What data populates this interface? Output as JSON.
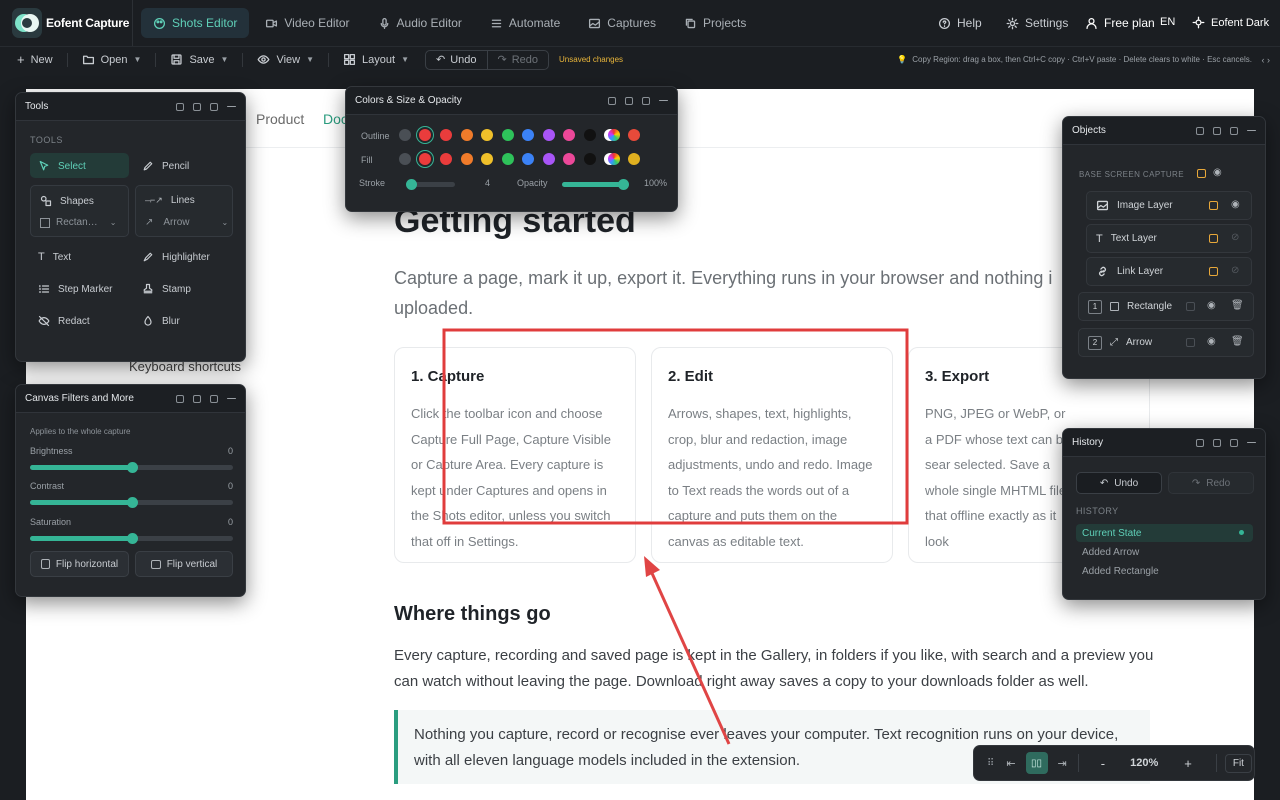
{
  "app": {
    "name": "Eofent Capture"
  },
  "tabs": [
    {
      "label": "Shots Editor",
      "icon": "palette-icon"
    },
    {
      "label": "Video Editor",
      "icon": "video-icon"
    },
    {
      "label": "Audio Editor",
      "icon": "mic-icon"
    },
    {
      "label": "Automate",
      "icon": "list-icon"
    },
    {
      "label": "Captures",
      "icon": "image-icon"
    },
    {
      "label": "Projects",
      "icon": "copy-icon"
    }
  ],
  "header_right": {
    "help": "Help",
    "settings": "Settings",
    "plan": "Free plan",
    "lang": "EN",
    "theme": "Eofent Dark"
  },
  "toolbar": {
    "new": "New",
    "open": "Open",
    "save": "Save",
    "view": "View",
    "layout": "Layout",
    "undo": "Undo",
    "redo": "Redo",
    "unsaved": "Unsaved changes",
    "hint": "Copy Region: drag a box, then Ctrl+C copy · Ctrl+V paste · Delete clears to white · Esc cancels.",
    "more": "‹ ›"
  },
  "doc": {
    "nav": [
      "Product",
      "Doc"
    ],
    "title": "Getting started",
    "intro": "Capture a page, mark it up, export it. Everything runs in your browser and nothing i uploaded.",
    "cards": [
      {
        "title": "1. Capture",
        "text": "Click the toolbar icon and choose Capture Full Page, Capture Visible or Capture Area. Every capture is kept under Captures and opens in the Shots editor, unless you switch that off in Settings."
      },
      {
        "title": "2. Edit",
        "text": "Arrows, shapes, text, highlights, crop, blur and redaction, image adjustments, undo and redo. Image to Text reads the words out of a capture and puts them on the canvas as editable text."
      },
      {
        "title": "3. Export",
        "text": "PNG, JPEG or WebP, or a PDF whose text can be sear selected. Save a whole single MHTML file that offline exactly as it look"
      }
    ],
    "where_title": "Where things go",
    "where_text": "Every capture, recording and saved page is kept in the Gallery, in folders if you like, with search and a preview you can watch without leaving the page. Download right away saves a copy to your downloads folder as well.",
    "quote": "Nothing you capture, record or recognise ever leaves your computer. Text recognition runs on your device, with all eleven language models included in the extension.",
    "keyboard": "Keyboard shortcuts"
  },
  "tools_panel": {
    "title": "Tools",
    "section": "TOOLS",
    "select": "Select",
    "pencil": "Pencil",
    "shapes": "Shapes",
    "shapes_sub": "Rectan…",
    "lines": "Lines",
    "lines_sub": "Arrow",
    "text": "Text",
    "highlighter": "Highlighter",
    "step_marker": "Step Marker",
    "stamp": "Stamp",
    "redact": "Redact",
    "blur": "Blur"
  },
  "filters_panel": {
    "title": "Canvas Filters and More",
    "note": "Applies to the whole capture",
    "brightness": "Brightness",
    "brightness_val": "0",
    "contrast": "Contrast",
    "contrast_val": "0",
    "saturation": "Saturation",
    "saturation_val": "0",
    "flip_h": "Flip horizontal",
    "flip_v": "Flip vertical",
    "brightness_level": 0.5,
    "contrast_level": 0.5,
    "saturation_level": 0.5
  },
  "colors_panel": {
    "title": "Colors & Size & Opacity",
    "outline": "Outline",
    "fill": "Fill",
    "stroke": "Stroke",
    "stroke_val": "4",
    "opacity": "Opacity",
    "opacity_val": "100%",
    "swatches": [
      "#ea3c3c",
      "#f07b2a",
      "#f0c02a",
      "#2ec25a",
      "#3b82f6",
      "#a855f7",
      "#ec4899",
      "#111111",
      "#ffffff"
    ]
  },
  "objects_panel": {
    "title": "Objects",
    "base": "BASE SCREEN CAPTURE",
    "layers": [
      {
        "name": "Image Layer"
      },
      {
        "name": "Text Layer"
      },
      {
        "name": "Link Layer"
      }
    ],
    "items": [
      {
        "num": "1",
        "name": "Rectangle"
      },
      {
        "num": "2",
        "name": "Arrow"
      }
    ]
  },
  "history_panel": {
    "title": "History",
    "undo": "Undo",
    "redo": "Redo",
    "section": "HISTORY",
    "entries": [
      "Current State",
      "Added Arrow",
      "Added Rectangle"
    ]
  },
  "zoom": {
    "value": "120%",
    "fit": "Fit",
    "minus": "-",
    "plus": "+"
  },
  "colors": {
    "accent": "#35b596",
    "warning": "#e8b53a",
    "annotation": "#e03c3c"
  }
}
